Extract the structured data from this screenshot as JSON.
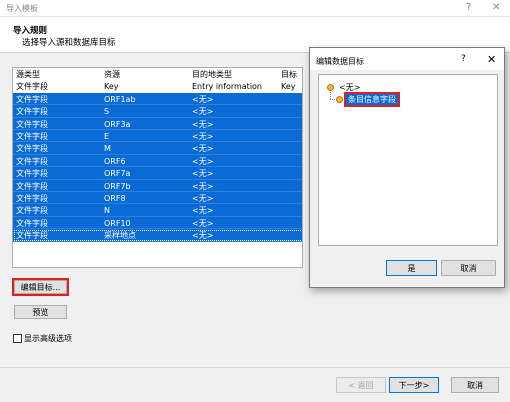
{
  "window": {
    "title": "导入模板",
    "help": "?",
    "close": "✕"
  },
  "header": {
    "title": "导入规则",
    "subtitle": "选择导入源和数据库目标"
  },
  "grid": {
    "columns": [
      "源类型",
      "资源",
      "目的地类型",
      "目标"
    ],
    "header_row": [
      "文件字段",
      "Key",
      "Entry information",
      "Key"
    ],
    "rows": [
      [
        "文件字段",
        "ORF1ab",
        "<无>",
        ""
      ],
      [
        "文件字段",
        "S",
        "<无>",
        ""
      ],
      [
        "文件字段",
        "ORF3a",
        "<无>",
        ""
      ],
      [
        "文件字段",
        "E",
        "<无>",
        ""
      ],
      [
        "文件字段",
        "M",
        "<无>",
        ""
      ],
      [
        "文件字段",
        "ORF6",
        "<无>",
        ""
      ],
      [
        "文件字段",
        "ORF7a",
        "<无>",
        ""
      ],
      [
        "文件字段",
        "ORF7b",
        "<无>",
        ""
      ],
      [
        "文件字段",
        "ORF8",
        "<无>",
        ""
      ],
      [
        "文件字段",
        "N",
        "<无>",
        ""
      ],
      [
        "文件字段",
        "ORF10",
        "<无>",
        ""
      ],
      [
        "文件字段",
        "采样地点",
        "<无>",
        ""
      ]
    ]
  },
  "buttons": {
    "edit_target": "编辑目标...",
    "preview": "预览",
    "back": "< 返回",
    "next": "下一步>",
    "cancel": "取消"
  },
  "options": {
    "show_advanced": "显示高级选项"
  },
  "popup": {
    "title": "编辑数据目标",
    "help": "?",
    "close": "✕",
    "tree": [
      {
        "label": "<无>",
        "selected": false
      },
      {
        "label": "条目信息字段",
        "selected": true
      }
    ],
    "ok": "是",
    "cancel": "取消"
  },
  "colors": {
    "selection": "#0a6ad6",
    "highlight": "#e02020",
    "node": "#f2b43a"
  }
}
